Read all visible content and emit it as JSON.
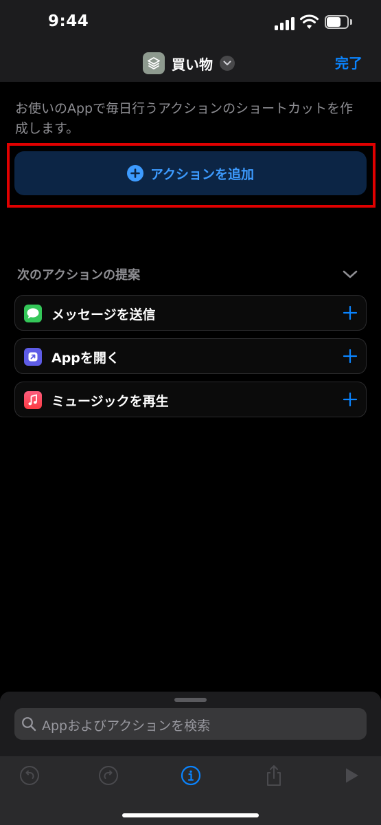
{
  "status_bar": {
    "time": "9:44"
  },
  "nav": {
    "title": "買い物",
    "done_label": "完了"
  },
  "description": "お使いのAppで毎日行うアクションのショートカットを作成します。",
  "add_action": {
    "label": "アクションを追加"
  },
  "suggestions": {
    "header": "次のアクションの提案",
    "items": [
      {
        "label": "メッセージを送信",
        "icon": "messages-icon",
        "color": "#34c759"
      },
      {
        "label": "Appを開く",
        "icon": "open-app-icon",
        "color": "#5e5ce6"
      },
      {
        "label": "ミュージックを再生",
        "icon": "music-icon",
        "color": "#fc3c44"
      }
    ]
  },
  "search": {
    "placeholder": "Appおよびアクションを検索"
  },
  "toolbar": {
    "icons": [
      "undo-icon",
      "redo-icon",
      "info-icon",
      "share-icon",
      "play-icon"
    ]
  },
  "colors": {
    "accent": "#0a84ff",
    "highlight": "#e00000",
    "add_button_bg": "#0c2545"
  }
}
